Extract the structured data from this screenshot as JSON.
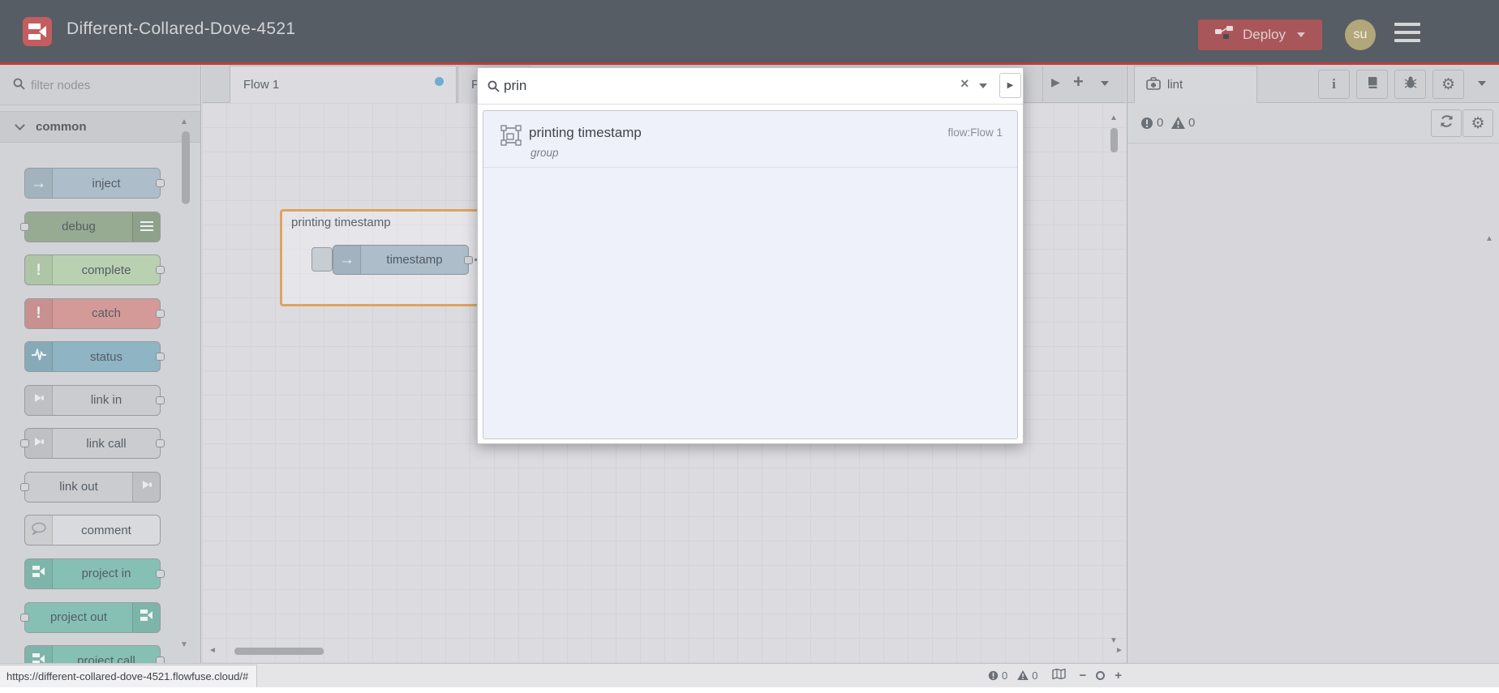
{
  "header": {
    "title": "Different-Collared-Dove-4521",
    "deploy_label": "Deploy",
    "avatar_text": "su"
  },
  "palette": {
    "filter_placeholder": "filter nodes",
    "category_label": "common",
    "nodes": [
      {
        "label": "inject",
        "color": "#adbeca",
        "icon": "arrow",
        "iconSide": "left",
        "ports": "right"
      },
      {
        "label": "debug",
        "color": "#97ab93",
        "icon": "lines",
        "iconSide": "right",
        "ports": "left"
      },
      {
        "label": "complete",
        "color": "#b9d1b0",
        "icon": "exclaim",
        "iconSide": "left",
        "ports": "right"
      },
      {
        "label": "catch",
        "color": "#d49a98",
        "icon": "exclaim",
        "iconSide": "left",
        "ports": "right"
      },
      {
        "label": "status",
        "color": "#8fb4c3",
        "icon": "pulse",
        "iconSide": "left",
        "ports": "right"
      },
      {
        "label": "link in",
        "color": "#cbccd0",
        "icon": "link",
        "iconSide": "left",
        "ports": "right"
      },
      {
        "label": "link call",
        "color": "#cbccd0",
        "icon": "link",
        "iconSide": "left",
        "ports": "both"
      },
      {
        "label": "link out",
        "color": "#cbccd0",
        "icon": "link",
        "iconSide": "right",
        "ports": "left"
      },
      {
        "label": "comment",
        "color": "#d9dadd",
        "icon": "comment",
        "iconSide": "left",
        "ports": "none"
      },
      {
        "label": "project in",
        "color": "#86c0b4",
        "icon": "project",
        "iconSide": "left",
        "ports": "right"
      },
      {
        "label": "project out",
        "color": "#86c0b4",
        "icon": "project",
        "iconSide": "right",
        "ports": "left"
      },
      {
        "label": "project call",
        "color": "#86c0b4",
        "icon": "project",
        "iconSide": "left",
        "ports": "right"
      }
    ]
  },
  "workspace": {
    "tab1_label": "Flow 1",
    "tab2_label": "Fl",
    "group_label": "printing timestamp",
    "inject_label": "timestamp"
  },
  "search": {
    "query": "prin",
    "result_title": "printing timestamp",
    "result_subtitle": "group",
    "result_flow": "flow:Flow 1"
  },
  "sidebar": {
    "tab_label": "lint",
    "error_count": "0",
    "warning_count": "0"
  },
  "footer": {
    "url": "https://different-collared-dove-4521.flowfuse.cloud/#",
    "error_count": "0",
    "warning_count": "0"
  },
  "icons": {
    "play": "▶",
    "plus": "+",
    "clear": "×",
    "up_arrow": "▲",
    "down_arrow": "▼",
    "left_arrow": "◄",
    "right_arrow": "►",
    "gear": "⚙",
    "info": "i",
    "zoom_in": "+",
    "zoom_out": "−",
    "inject_arrow": "→",
    "exclaim": "!"
  },
  "colors": {
    "brand_red": "#c25e60",
    "deploy_red": "#a9565a",
    "accent_line": "#c13c3e",
    "group_border": "#dfa35f",
    "modified_dot": "#72add0",
    "result_bg": "#eef0fa"
  }
}
